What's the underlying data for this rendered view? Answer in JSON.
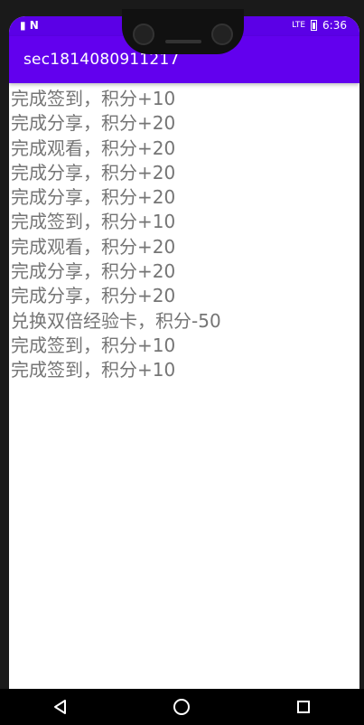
{
  "status_bar": {
    "left_icons": [
      "signal-icon",
      "notification-n-icon"
    ],
    "right_text": "6:36",
    "lte_label": "LTE",
    "colors": {
      "background": "#5b00e6"
    }
  },
  "app_bar": {
    "title": "sec1814080911217",
    "colors": {
      "background": "#6200ee",
      "text": "#ffffff"
    }
  },
  "list": {
    "items": [
      "完成签到，积分+10",
      "完成分享，积分+20",
      "完成观看，积分+20",
      "完成分享，积分+20",
      "完成分享，积分+20",
      "完成签到，积分+10",
      "完成观看，积分+20",
      "完成分享，积分+20",
      "完成分享，积分+20",
      "兑换双倍经验卡，积分-50",
      "完成签到，积分+10",
      "完成签到，积分+10"
    ],
    "text_color": "#757575"
  },
  "nav_bar": {
    "buttons": [
      "back-icon",
      "home-icon",
      "recents-icon"
    ]
  }
}
